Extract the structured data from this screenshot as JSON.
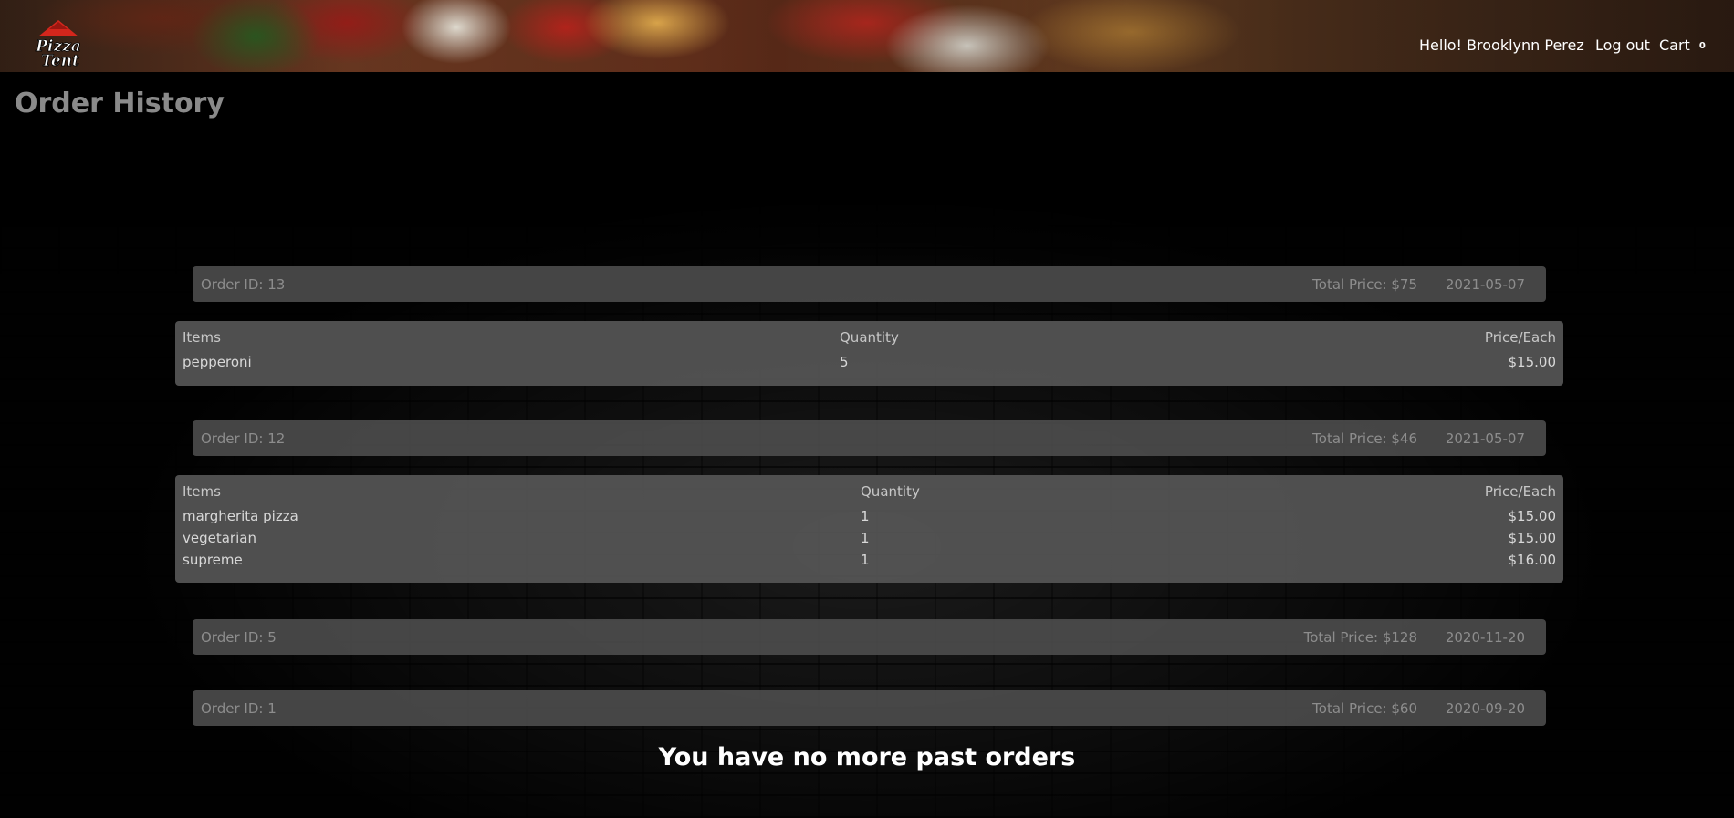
{
  "header": {
    "logo_text_line1": "Pizza",
    "logo_text_line2": "Tent",
    "greeting": "Hello! Brooklynn Perez",
    "logout_label": "Log out",
    "cart_label": "Cart",
    "cart_count": "0"
  },
  "page": {
    "title": "Order History",
    "end_message": "You have no more past orders"
  },
  "orders": [
    {
      "id_text": "Order ID: 13",
      "total_text": "Total Price: $75",
      "date": "2021-05-07",
      "expanded": true,
      "columns": [
        "Items",
        "Quantity",
        "Price/Each"
      ],
      "items": [
        {
          "name": "pepperoni",
          "qty": "5",
          "price": "$15.00"
        }
      ]
    },
    {
      "id_text": "Order ID: 12",
      "total_text": "Total Price: $46",
      "date": "2021-05-07",
      "expanded": true,
      "columns": [
        "Items",
        "Quantity",
        "Price/Each"
      ],
      "items": [
        {
          "name": "margherita pizza",
          "qty": "1",
          "price": "$15.00"
        },
        {
          "name": "vegetarian",
          "qty": "1",
          "price": "$15.00"
        },
        {
          "name": "supreme",
          "qty": "1",
          "price": "$16.00"
        }
      ]
    },
    {
      "id_text": "Order ID: 5",
      "total_text": "Total Price: $128",
      "date": "2020-11-20",
      "expanded": false
    },
    {
      "id_text": "Order ID: 1",
      "total_text": "Total Price: $60",
      "date": "2020-09-20",
      "expanded": false
    }
  ]
}
